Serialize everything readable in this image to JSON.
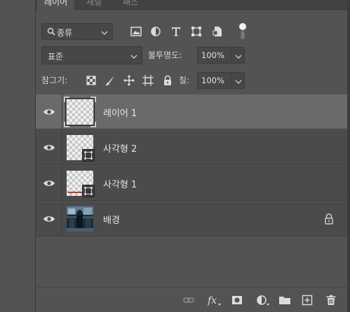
{
  "tabs": [
    {
      "label": "레이어",
      "active": true
    },
    {
      "label": "채널",
      "active": false
    },
    {
      "label": "패스",
      "active": false
    }
  ],
  "filter": {
    "kind_label": "종류"
  },
  "blend": {
    "mode": "표준",
    "opacity_label": "불투명도:",
    "opacity_value": "100%"
  },
  "lock": {
    "label": "잠그기:",
    "fill_label": "칠:",
    "fill_value": "100%"
  },
  "layers": [
    {
      "name": "레이어 1",
      "selected": true,
      "type": "pixel"
    },
    {
      "name": "사각형 2",
      "selected": false,
      "type": "shape"
    },
    {
      "name": "사각형 1",
      "selected": false,
      "type": "shape"
    },
    {
      "name": "배경",
      "selected": false,
      "type": "background",
      "locked": true
    }
  ],
  "colors": {
    "panel_bg": "#535353",
    "selected_row": "#6a6a6a",
    "row_bg": "#4b4b4b"
  }
}
